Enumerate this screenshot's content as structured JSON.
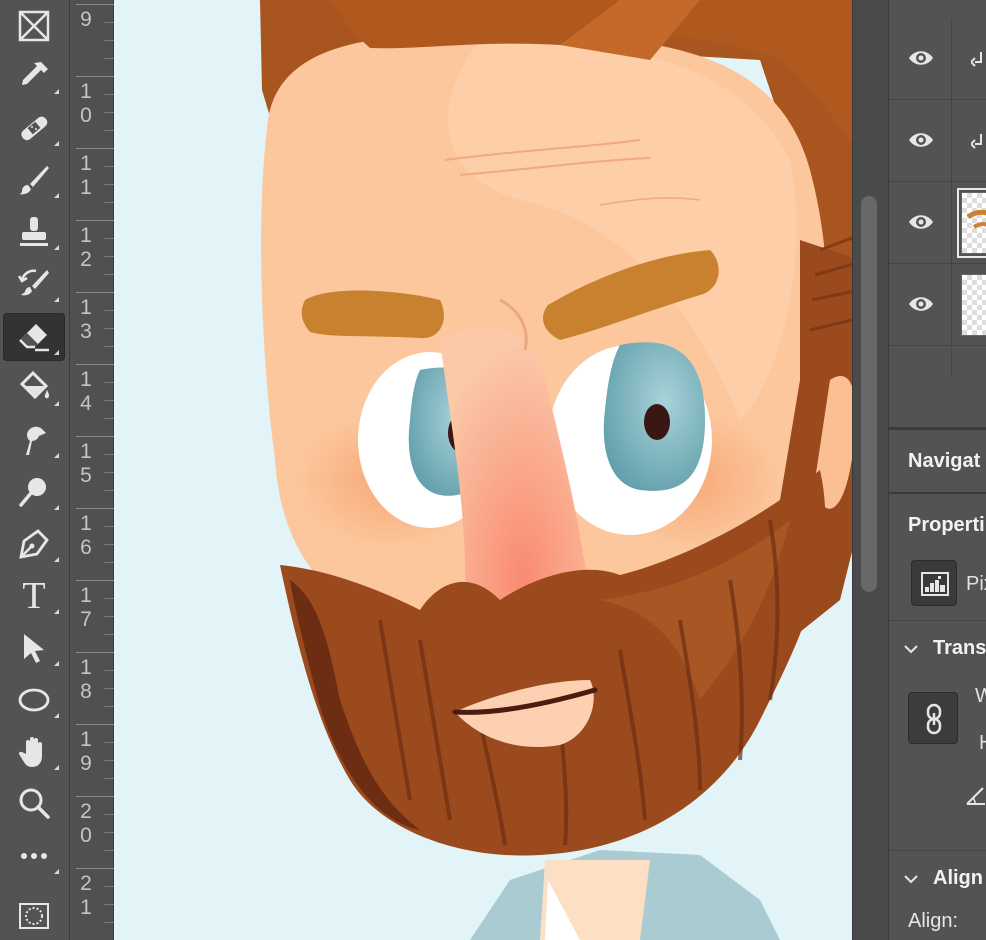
{
  "toolbar": {
    "tools": [
      {
        "name": "frame-tool",
        "icon": "frame-icon",
        "active": false
      },
      {
        "name": "eyedropper-tool",
        "icon": "eyedropper-icon",
        "active": false
      },
      {
        "name": "healing-brush-tool",
        "icon": "bandage-icon",
        "active": false
      },
      {
        "name": "brush-tool",
        "icon": "brush-icon",
        "active": false
      },
      {
        "name": "clone-stamp-tool",
        "icon": "stamp-icon",
        "active": false
      },
      {
        "name": "history-brush-tool",
        "icon": "history-brush-icon",
        "active": false
      },
      {
        "name": "eraser-tool",
        "icon": "eraser-icon",
        "active": true
      },
      {
        "name": "paint-bucket-tool",
        "icon": "paint-bucket-icon",
        "active": false
      },
      {
        "name": "smudge-tool",
        "icon": "smudge-icon",
        "active": false
      },
      {
        "name": "dodge-tool",
        "icon": "dodge-icon",
        "active": false
      },
      {
        "name": "pen-tool",
        "icon": "pen-icon",
        "active": false
      },
      {
        "name": "type-tool",
        "icon": "type-icon",
        "active": false
      },
      {
        "name": "path-selection-tool",
        "icon": "arrow-icon",
        "active": false
      },
      {
        "name": "ellipse-tool",
        "icon": "ellipse-icon",
        "active": false
      },
      {
        "name": "hand-tool",
        "icon": "hand-icon",
        "active": false
      },
      {
        "name": "zoom-tool",
        "icon": "zoom-icon",
        "active": false
      },
      {
        "name": "more-tools",
        "icon": "more-icon",
        "active": false
      },
      {
        "name": "quick-mask",
        "icon": "quick-mask-icon",
        "active": false
      }
    ],
    "type_glyph": "T"
  },
  "ruler": {
    "marks": [
      {
        "d1": "9",
        "d2": ""
      },
      {
        "d1": "1",
        "d2": "0"
      },
      {
        "d1": "1",
        "d2": "1"
      },
      {
        "d1": "1",
        "d2": "2"
      },
      {
        "d1": "1",
        "d2": "3"
      },
      {
        "d1": "1",
        "d2": "4"
      },
      {
        "d1": "1",
        "d2": "5"
      },
      {
        "d1": "1",
        "d2": "6"
      },
      {
        "d1": "1",
        "d2": "7"
      },
      {
        "d1": "1",
        "d2": "8"
      },
      {
        "d1": "1",
        "d2": "9"
      },
      {
        "d1": "2",
        "d2": "0"
      },
      {
        "d1": "2",
        "d2": "1"
      }
    ]
  },
  "colors": {
    "canvas_bg": "#e2f4f7",
    "skin": "#fcc79d",
    "beard": "#9a4a1c",
    "eyebrow": "#c8822f",
    "iris": "#72adb9",
    "nose": "#f59a84",
    "panel_bg": "#535353"
  },
  "layers": [
    {
      "visible": true,
      "clipped": true,
      "icon": "eye-icon"
    },
    {
      "visible": true,
      "clipped": true,
      "icon": "eye-icon"
    },
    {
      "visible": true,
      "clipped": false,
      "icon": "eye-icon",
      "selected": true
    },
    {
      "visible": true,
      "clipped": false,
      "icon": "eye-icon"
    }
  ],
  "panels": {
    "navigator_title": "Navigat",
    "properties_title": "Properti",
    "properties_type": "Pix",
    "transform_title": "Trans",
    "transform_w": "W",
    "transform_h": "H",
    "align_title": "Align",
    "align_label": "Align:"
  }
}
